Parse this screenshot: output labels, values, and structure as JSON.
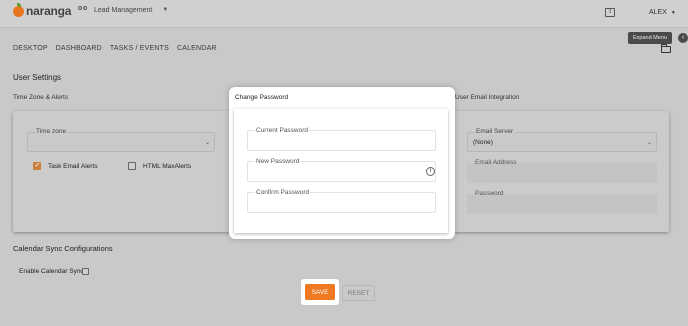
{
  "brand": {
    "logo_text": "naranga",
    "logo_color": "#e8741f"
  },
  "header": {
    "app_switch_label": "Lead Management",
    "user_name": "ALEX"
  },
  "nav": {
    "items": [
      "DESKTOP",
      "DASHBOARD",
      "TASKS / EVENTS",
      "CALENDAR"
    ],
    "tooltip": "Expand Menu"
  },
  "page": {
    "title": "User Settings",
    "timezone_section": "Time Zone & Alerts",
    "email_section": "User Email Integration",
    "calendar_section": "Calendar Sync Configurations"
  },
  "timezone_card": {
    "timezone_label": "Time zone",
    "timezone_value": "",
    "task_email_alerts": {
      "label": "Task Email Alerts",
      "checked": true
    },
    "html_max_alerts": {
      "label": "HTML MaxAlerts",
      "checked": false
    }
  },
  "email_card": {
    "email_server_label": "Email Server",
    "email_server_value": "(None)",
    "email_address_label": "Email Address",
    "password_label": "Password"
  },
  "calendar": {
    "enable_sync_label": "Enable Calendar Sync:",
    "enable_sync_checked": false
  },
  "modal": {
    "title": "Change Password",
    "current_password_label": "Current Password",
    "new_password_label": "New Password",
    "confirm_password_label": "Confirm Password"
  },
  "actions": {
    "save_label": "SAVE",
    "reset_label": "RESET",
    "save_color": "#ef7a23"
  }
}
